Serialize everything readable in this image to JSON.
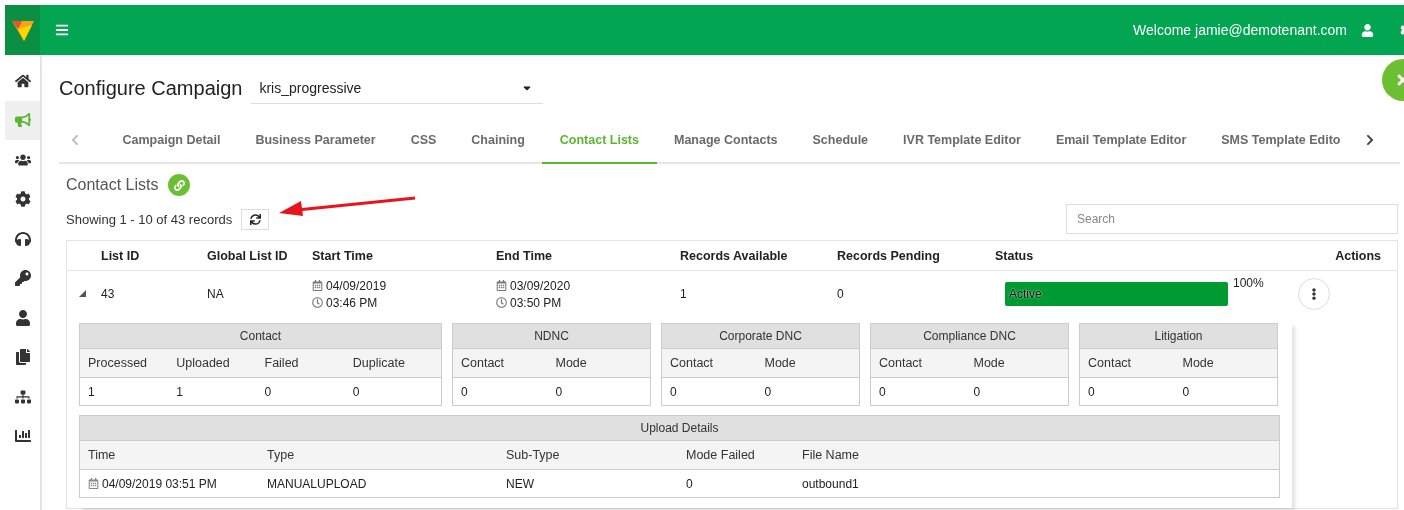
{
  "topbar": {
    "welcome": "Welcome jamie@demotenant.com"
  },
  "sidebar": {
    "items": [
      {
        "selected": false
      },
      {
        "selected": true
      },
      {
        "selected": false
      },
      {
        "selected": false
      },
      {
        "selected": false
      },
      {
        "selected": false
      },
      {
        "selected": false
      },
      {
        "selected": false
      },
      {
        "selected": false
      },
      {
        "selected": false
      }
    ]
  },
  "page": {
    "title": "Configure Campaign",
    "campaign_select": {
      "value": "kris_progressive"
    }
  },
  "tabs": [
    {
      "label": "Campaign Detail",
      "selected": false
    },
    {
      "label": "Business Parameter",
      "selected": false
    },
    {
      "label": "CSS",
      "selected": false
    },
    {
      "label": "Chaining",
      "selected": false
    },
    {
      "label": "Contact Lists",
      "selected": true
    },
    {
      "label": "Manage Contacts",
      "selected": false
    },
    {
      "label": "Schedule",
      "selected": false
    },
    {
      "label": "IVR Template Editor",
      "selected": false
    },
    {
      "label": "Email Template Editor",
      "selected": false
    },
    {
      "label": "SMS Template Edito",
      "selected": false
    }
  ],
  "section": {
    "title": "Contact Lists",
    "records_text": "Showing 1 - 10 of 43 records",
    "search": {
      "placeholder": "Search"
    }
  },
  "table": {
    "columns": [
      "List ID",
      "Global List ID",
      "Start Time",
      "End Time",
      "Records Available",
      "Records Pending",
      "Status",
      "Actions"
    ],
    "rows": [
      {
        "expanded": true,
        "list_id": "43",
        "global_list_id": "NA",
        "start_date": "04/09/2019",
        "start_time": "03:46 PM",
        "end_date": "03/09/2020",
        "end_time": "03:50 PM",
        "records_available": "1",
        "records_pending": "0",
        "status": {
          "label": "Active",
          "level": 1
        },
        "percent": "100%",
        "details": [
          {
            "title": "Contact",
            "columns": [
              "Processed",
              "Uploaded",
              "Failed",
              "Duplicate"
            ],
            "values": [
              "1",
              "1",
              "0",
              "0"
            ]
          },
          {
            "title": "NDNC",
            "columns": [
              "Contact",
              "Mode"
            ],
            "values": [
              "0",
              "0"
            ]
          },
          {
            "title": "Corporate DNC",
            "columns": [
              "Contact",
              "Mode"
            ],
            "values": [
              "0",
              "0"
            ]
          },
          {
            "title": "Compliance DNC",
            "columns": [
              "Contact",
              "Mode"
            ],
            "values": [
              "0",
              "0"
            ]
          },
          {
            "title": "Litigation",
            "columns": [
              "Contact",
              "Mode"
            ],
            "values": [
              "0",
              "0"
            ]
          }
        ],
        "upload_details": {
          "title": "Upload Details",
          "columns": [
            "Time",
            "Type",
            "Sub-Type",
            "Mode Failed",
            "File Name"
          ],
          "rows": [
            [
              "04/09/2019 03:51 PM",
              "MANUALUPLOAD",
              "NEW",
              "0",
              "outbound1"
            ]
          ]
        }
      }
    ]
  }
}
